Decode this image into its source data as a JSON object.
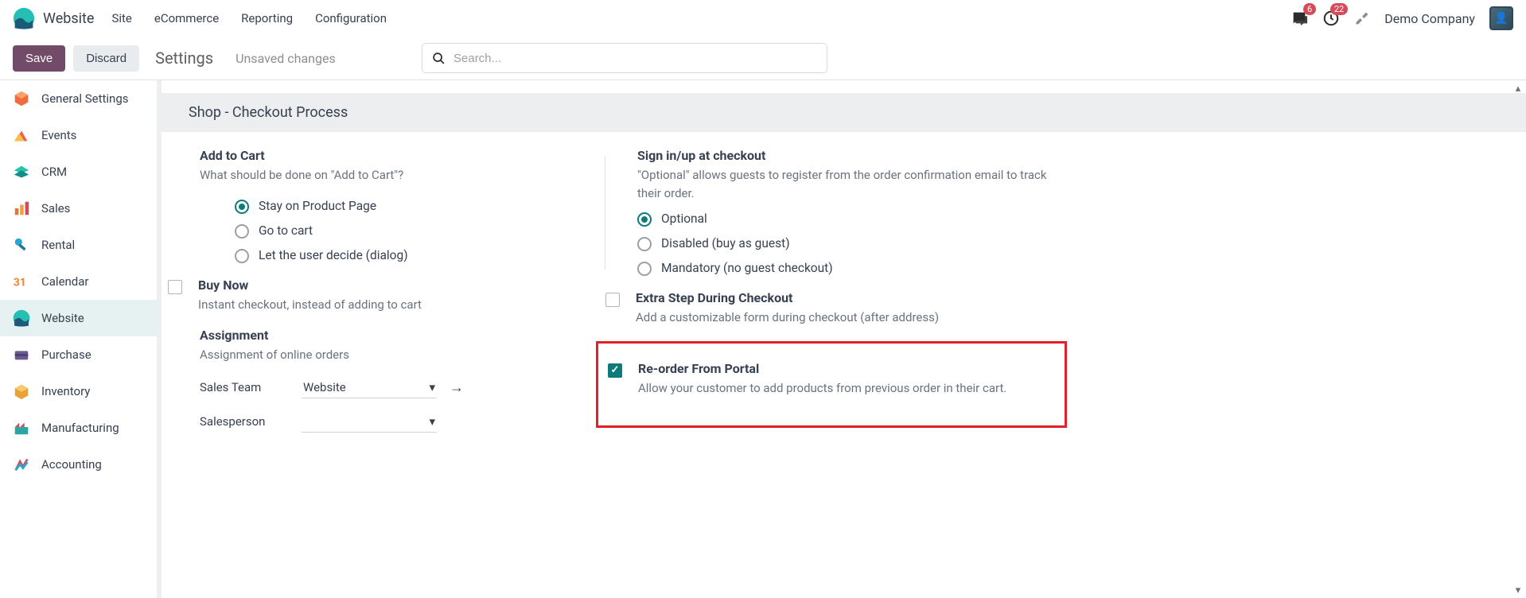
{
  "navbar": {
    "app_name": "Website",
    "menus": [
      "Site",
      "eCommerce",
      "Reporting",
      "Configuration"
    ],
    "messages_badge": "6",
    "activities_badge": "22",
    "company": "Demo Company"
  },
  "controlbar": {
    "save": "Save",
    "discard": "Discard",
    "title": "Settings",
    "status": "Unsaved changes",
    "search_placeholder": "Search..."
  },
  "sidebar": {
    "items": [
      {
        "label": "General Settings"
      },
      {
        "label": "Events"
      },
      {
        "label": "CRM"
      },
      {
        "label": "Sales"
      },
      {
        "label": "Rental"
      },
      {
        "label": "Calendar"
      },
      {
        "label": "Website"
      },
      {
        "label": "Purchase"
      },
      {
        "label": "Inventory"
      },
      {
        "label": "Manufacturing"
      },
      {
        "label": "Accounting"
      }
    ]
  },
  "section": {
    "title": "Shop - Checkout Process"
  },
  "left": {
    "add_to_cart": {
      "title": "Add to Cart",
      "desc": "What should be done on \"Add to Cart\"?",
      "opt1": "Stay on Product Page",
      "opt2": "Go to cart",
      "opt3": "Let the user decide (dialog)"
    },
    "buy_now": {
      "title": "Buy Now",
      "desc": "Instant checkout, instead of adding to cart"
    },
    "assignment": {
      "title": "Assignment",
      "desc": "Assignment of online orders",
      "sales_team_label": "Sales Team",
      "sales_team_value": "Website",
      "salesperson_label": "Salesperson"
    }
  },
  "right": {
    "signin": {
      "title": "Sign in/up at checkout",
      "desc": "\"Optional\" allows guests to register from the order confirmation email to track their order.",
      "opt1": "Optional",
      "opt2": "Disabled (buy as guest)",
      "opt3": "Mandatory (no guest checkout)"
    },
    "extra_step": {
      "title": "Extra Step During Checkout",
      "desc": "Add a customizable form during checkout (after address)"
    },
    "reorder": {
      "title": "Re-order From Portal",
      "desc": "Allow your customer to add products from previous order in their cart."
    }
  }
}
